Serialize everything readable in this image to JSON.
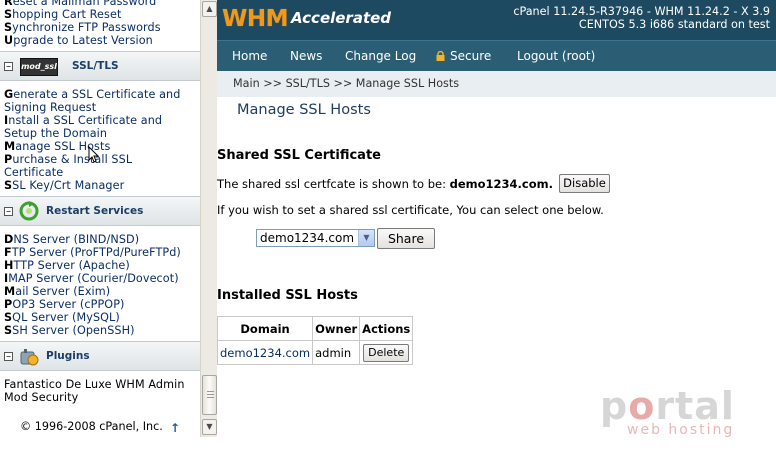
{
  "sidebar": {
    "top_items": [
      {
        "first": "R",
        "rest": "eset a Mailman Password"
      },
      {
        "first": "S",
        "rest": "hopping Cart Reset"
      },
      {
        "first": "S",
        "rest": "ynchronize FTP Passwords"
      },
      {
        "first": "U",
        "rest": "pgrade to Latest Version"
      }
    ],
    "ssl": {
      "icon_text": "mod_ssl",
      "title": "SSL/TLS",
      "items": [
        {
          "first": "G",
          "rest": "enerate a SSL Certificate and"
        },
        {
          "first": "",
          "rest": "Signing Request"
        },
        {
          "first": "I",
          "rest": "nstall a SSL Certificate and"
        },
        {
          "first": "",
          "rest": "Setup the Domain"
        },
        {
          "first": "M",
          "rest": "anage SSL Hosts"
        },
        {
          "first": "P",
          "rest": "urchase & Install SSL"
        },
        {
          "first": "",
          "rest": "Certificate"
        },
        {
          "first": "S",
          "rest": "SL Key/Crt Manager"
        }
      ]
    },
    "restart": {
      "title": "Restart Services",
      "items": [
        {
          "first": "D",
          "rest": "NS Server (BIND/NSD)"
        },
        {
          "first": "F",
          "rest": "TP Server (ProFTPd/PureFTPd)"
        },
        {
          "first": "H",
          "rest": "TTP Server (Apache)"
        },
        {
          "first": "I",
          "rest": "MAP Server (Courier/Dovecot)"
        },
        {
          "first": "M",
          "rest": "ail Server (Exim)"
        },
        {
          "first": "P",
          "rest": "OP3 Server (cPPOP)"
        },
        {
          "first": "S",
          "rest": "QL Server (MySQL)"
        },
        {
          "first": "S",
          "rest": "SH Server (OpenSSH)"
        }
      ]
    },
    "plugins": {
      "title": "Plugins",
      "items": [
        {
          "first": "",
          "rest": "Fantastico De Luxe WHM Admin"
        },
        {
          "first": "",
          "rest": "Mod Security"
        }
      ]
    },
    "toggle_symbol": "−",
    "copyright": "© 1996-2008 cPanel, Inc.",
    "copyright_arrow": "↑"
  },
  "header": {
    "logo_main": "WHM",
    "logo_sub": "Accelerated",
    "version_line1": "cPanel 11.24.5-R37946 - WHM 11.24.2 - X 3.9",
    "version_line2": "CENTOS 5.3 i686 standard on test"
  },
  "nav": {
    "home": "Home",
    "news": "News",
    "changelog": "Change Log",
    "secure": "Secure",
    "logout": "Logout (root)"
  },
  "breadcrumb": "Main >> SSL/TLS >> Manage SSL Hosts",
  "page": {
    "title": "Manage SSL Hosts",
    "shared_heading": "Shared SSL Certificate",
    "shared_text": "The shared ssl certfcate is shown to be: ",
    "shared_domain": "demo1234.com.",
    "disable_label": "Disable",
    "select_text": "If you wish to set a shared ssl certificate, You can select one below.",
    "select_value": "demo1234.com",
    "share_label": "Share",
    "installed_heading": "Installed SSL Hosts",
    "table": {
      "headers": [
        "Domain",
        "Owner",
        "Actions"
      ],
      "rows": [
        {
          "domain": "demo1234.com",
          "owner": "admin",
          "action": "Delete"
        }
      ]
    }
  },
  "watermark": {
    "main_p": "p",
    "main_o": "o",
    "main_rest": "rtal",
    "sub": "web hosting"
  },
  "colors": {
    "topbar": "#1e4a61",
    "navbar": "#2b5e74",
    "logo_orange": "#f09a1c",
    "breadcrumb_bg": "#e8eef1",
    "link": "#0a2e66"
  }
}
